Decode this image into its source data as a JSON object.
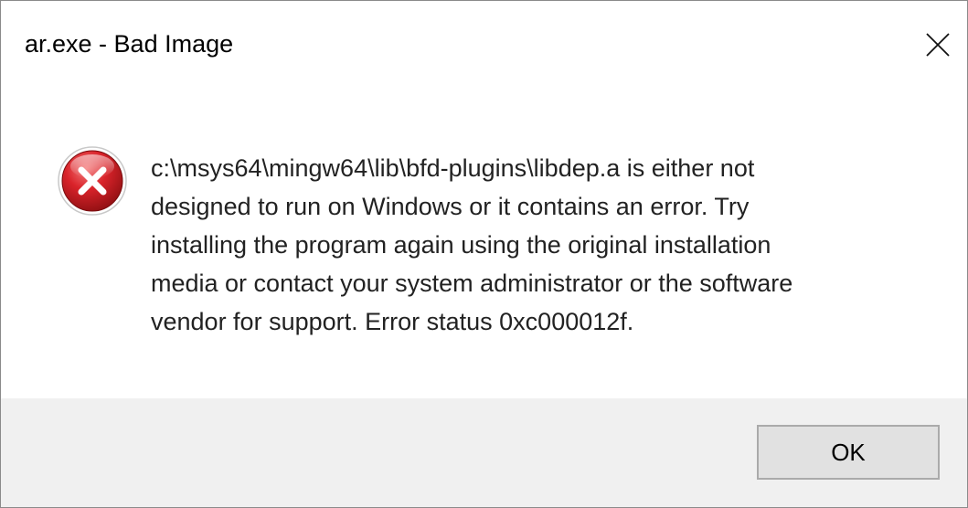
{
  "window": {
    "title": "ar.exe - Bad Image"
  },
  "icons": {
    "close": "close-icon",
    "error": "error-icon"
  },
  "message": {
    "text": "c:\\msys64\\mingw64\\lib\\bfd-plugins\\libdep.a is either not\ndesigned to run on Windows or it contains an error. Try\ninstalling the program again using the original installation\nmedia or contact your system administrator or the software\nvendor for support. Error status 0xc000012f."
  },
  "buttons": {
    "ok_label": "OK"
  },
  "colors": {
    "error_red": "#d9232a",
    "footer_bg": "#f0f0f0"
  }
}
